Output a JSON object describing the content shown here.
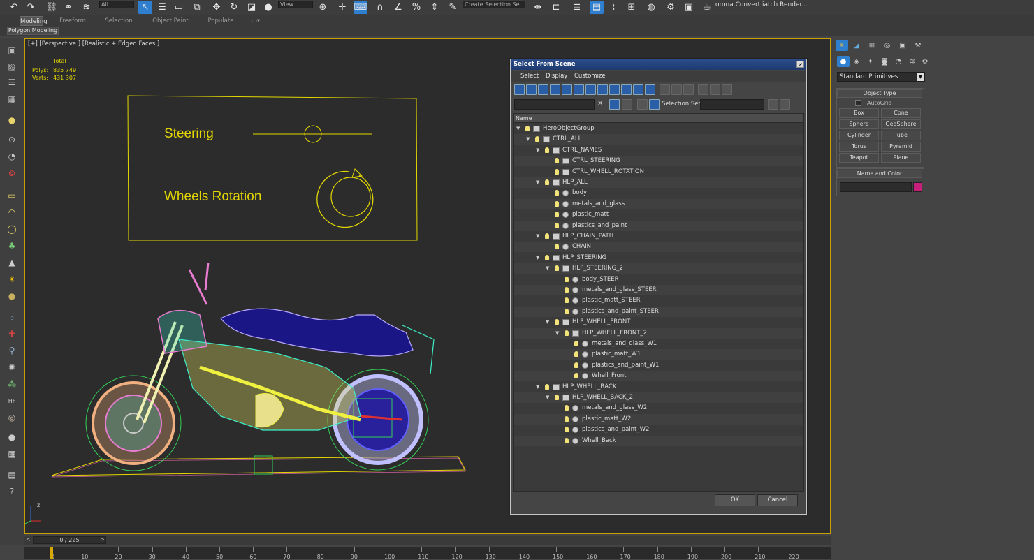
{
  "toolbar": {
    "filter_dropdown": "All",
    "refcoord_dropdown": "View",
    "selection_set_dropdown": "Create Selection Se",
    "render_label": "orona Convert iatch Render..."
  },
  "ribbon": {
    "tabs": [
      "Modeling",
      "Freeform",
      "Selection",
      "Object Paint",
      "Populate"
    ],
    "active_tab": "Modeling",
    "sub_label": "Polygon Modeling"
  },
  "viewport": {
    "label": "[+] [Perspective ] [Realistic + Edged Faces ]",
    "stats": {
      "total_label": "Total",
      "polys_label": "Polys:",
      "polys": "835 749",
      "verts_label": "Verts:",
      "verts": "431 307"
    },
    "panel_texts": {
      "steering": "Steering",
      "wheels": "Wheels Rotation"
    },
    "axis_label": "z"
  },
  "dialog": {
    "title": "Select From Scene",
    "close": "×",
    "menu": [
      "Select",
      "Display",
      "Customize"
    ],
    "selection_set_label": "Selection Set:",
    "column_name": "Name",
    "rows": [
      {
        "label": "HeroObjectGroup",
        "level": 0,
        "kind": "group"
      },
      {
        "label": "CTRL_ALL",
        "level": 1,
        "kind": "group"
      },
      {
        "label": "CTRL_NAMES",
        "level": 2,
        "kind": "group"
      },
      {
        "label": "CTRL_STEERING",
        "level": 3,
        "kind": "group"
      },
      {
        "label": "CTRL_WHELL_ROTATION",
        "level": 3,
        "kind": "group"
      },
      {
        "label": "HLP_ALL",
        "level": 2,
        "kind": "helper"
      },
      {
        "label": "body",
        "level": 3,
        "kind": "object"
      },
      {
        "label": "metals_and_glass",
        "level": 3,
        "kind": "object"
      },
      {
        "label": "plastic_matt",
        "level": 3,
        "kind": "object"
      },
      {
        "label": "plastics_and_paint",
        "level": 3,
        "kind": "object"
      },
      {
        "label": "HLP_CHAIN_PATH",
        "level": 2,
        "kind": "group"
      },
      {
        "label": "CHAIN",
        "level": 3,
        "kind": "object"
      },
      {
        "label": "HLP_STEERING",
        "level": 2,
        "kind": "group"
      },
      {
        "label": "HLP_STEERING_2",
        "level": 3,
        "kind": "helper"
      },
      {
        "label": "body_STEER",
        "level": 4,
        "kind": "object"
      },
      {
        "label": "metals_and_glass_STEER",
        "level": 4,
        "kind": "object"
      },
      {
        "label": "plastic_matt_STEER",
        "level": 4,
        "kind": "object"
      },
      {
        "label": "plastics_and_paint_STEER",
        "level": 4,
        "kind": "object"
      },
      {
        "label": "HLP_WHELL_FRONT",
        "level": 3,
        "kind": "group"
      },
      {
        "label": "HLP_WHELL_FRONT_2",
        "level": 4,
        "kind": "helper"
      },
      {
        "label": "metals_and_glass_W1",
        "level": 5,
        "kind": "object"
      },
      {
        "label": "plastic_matt_W1",
        "level": 5,
        "kind": "object"
      },
      {
        "label": "plastics_and_paint_W1",
        "level": 5,
        "kind": "object"
      },
      {
        "label": "Whell_Front",
        "level": 5,
        "kind": "object"
      },
      {
        "label": "HLP_WHELL_BACK",
        "level": 2,
        "kind": "group"
      },
      {
        "label": "HLP_WHELL_BACK_2",
        "level": 3,
        "kind": "helper"
      },
      {
        "label": "metals_and_glass_W2",
        "level": 4,
        "kind": "object"
      },
      {
        "label": "plastic_matt_W2",
        "level": 4,
        "kind": "object"
      },
      {
        "label": "plastics_and_paint_W2",
        "level": 4,
        "kind": "object"
      },
      {
        "label": "Whell_Back",
        "level": 4,
        "kind": "object"
      }
    ],
    "ok": "OK",
    "cancel": "Cancel"
  },
  "command_panel": {
    "category_dropdown": "Standard Primitives",
    "object_type_header": "Object Type",
    "autogrid": "AutoGrid",
    "buttons": [
      "Box",
      "Cone",
      "Sphere",
      "GeoSphere",
      "Cylinder",
      "Tube",
      "Torus",
      "Pyramid",
      "Teapot",
      "Plane"
    ],
    "name_color_header": "Name and Color",
    "object_color": "#c8207a"
  },
  "timeline": {
    "frame_display": "0 / 225",
    "prev": "<",
    "next": ">",
    "ticks": [
      "0",
      "10",
      "20",
      "30",
      "40",
      "50",
      "60",
      "70",
      "80",
      "90",
      "100",
      "110",
      "120",
      "130",
      "140",
      "150",
      "160",
      "170",
      "180",
      "190",
      "200",
      "210",
      "220"
    ]
  },
  "colors": {
    "accent": "#2f7fd0",
    "viewport_border": "#c8a000",
    "wire_yellow": "#e4d800"
  }
}
